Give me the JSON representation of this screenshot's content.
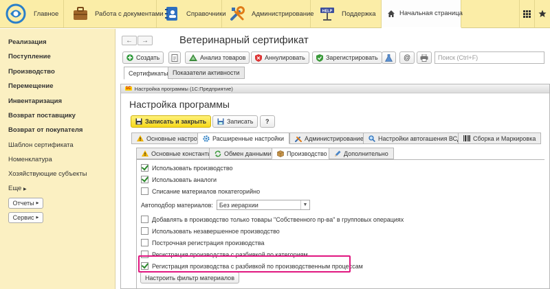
{
  "topbar": {
    "main": "Главное",
    "docs": "Работа с документами",
    "refs": "Справочники",
    "admin": "Администрирование",
    "support": "Поддержка",
    "home": "Начальная страница",
    "support_badge": "HELP"
  },
  "sidebar": {
    "bold_items": [
      "Реализация",
      "Поступление",
      "Производство",
      "Перемещение",
      "Инвентаризация",
      "Возврат поставщику",
      "Возврат от покупателя"
    ],
    "items": [
      "Шаблон сертификата",
      "Номенклатура",
      "Хозяйствующие субъекты"
    ],
    "more": "Еще",
    "reports": "Отчеты",
    "service": "Сервис"
  },
  "doc": {
    "back": "←",
    "forward": "→",
    "title": "Ветеринарный сертификат",
    "toolbar": {
      "create": "Создать",
      "analyze": "Анализ товаров",
      "cancel": "Аннулировать",
      "register": "Зарегистрировать",
      "at": "@",
      "search_placeholder": "Поиск (Ctrl+F)"
    },
    "tabs": [
      "Сертификаты",
      "Показатели активности"
    ]
  },
  "dialog": {
    "window_title": "Настройка программы  (1С:Предприятие)",
    "app_badge": "1С",
    "title": "Настройка программы",
    "save_close": "Записать и закрыть",
    "save": "Записать",
    "help": "?",
    "tabs": [
      "Основные настройки",
      "Расширенные настройки",
      "Администрирование",
      "Настройки автогашения ВСД",
      "Сборка и Маркировка"
    ],
    "subtabs": [
      "Основные константы",
      "Обмен данными",
      "Производство",
      "Дополнительно"
    ],
    "options": [
      {
        "label": "Использовать производство",
        "checked": true
      },
      {
        "label": "Использовать аналоги",
        "checked": true
      },
      {
        "label": "Списание материалов покатегорийно",
        "checked": false
      }
    ],
    "autoselect_label": "Автоподбор материалов:",
    "autoselect_value": "Без иерархии",
    "options2": [
      {
        "label": "Добавлять в производство только товары  \"Собственного пр-ва\" в групповых операциях",
        "checked": false
      },
      {
        "label": "Использовать незавершенное производство",
        "checked": false
      },
      {
        "label": "Построчная регистрация производства",
        "checked": false
      },
      {
        "label": "Регистрация производства с разбивкой по категориям",
        "checked": false
      },
      {
        "label": "Регистрация производства с разбивкой по производственным процессам",
        "checked": true
      }
    ],
    "filter_button": "Настроить фильтр материалов"
  },
  "colors": {
    "topbar_bg": "#fbeda7",
    "sidebar_bg": "#fbf0c2",
    "highlight": "#e0157f",
    "save_button": "#f6d81a"
  }
}
